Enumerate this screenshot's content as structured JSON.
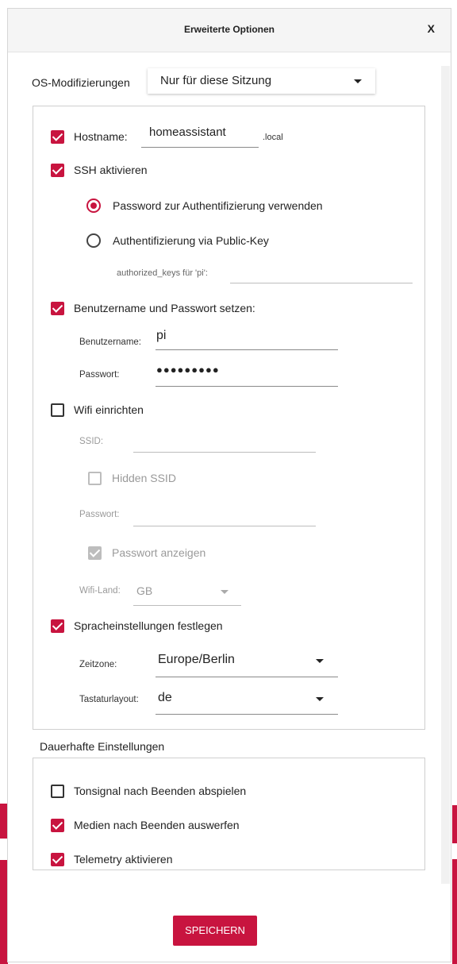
{
  "dialog": {
    "title": "Erweiterte Optionen",
    "close": "X"
  },
  "os_mod": {
    "label": "OS-Modifizierungen",
    "value": "Nur für diese Sitzung"
  },
  "hostname": {
    "label": "Hostname:",
    "value": "homeassistant",
    "suffix": ".local",
    "checked": true
  },
  "ssh": {
    "label": "SSH aktivieren",
    "checked": true,
    "opt_password": "Password zur Authentifizierung verwenden",
    "opt_pubkey": "Authentifizierung via Public-Key",
    "keys_label": "authorized_keys für 'pi':",
    "selected": "password"
  },
  "user": {
    "label": "Benutzername und Passwort setzen:",
    "checked": true,
    "username_label": "Benutzername:",
    "username": "pi",
    "password_label": "Passwort:",
    "password": "●●●●●●●●●"
  },
  "wifi": {
    "label": "Wifi einrichten",
    "checked": false,
    "ssid_label": "SSID:",
    "hidden_label": "Hidden SSID",
    "password_label": "Passwort:",
    "show_password_label": "Passwort anzeigen",
    "country_label": "Wifi-Land:",
    "country": "GB"
  },
  "locale": {
    "label": "Spracheinstellungen festlegen",
    "checked": true,
    "tz_label": "Zeitzone:",
    "tz": "Europe/Berlin",
    "kb_label": "Tastaturlayout:",
    "kb": "de"
  },
  "persistent": {
    "heading": "Dauerhafte Einstellungen",
    "beep": "Tonsignal nach Beenden abspielen",
    "beep_checked": false,
    "eject": "Medien nach Beenden auswerfen",
    "eject_checked": true,
    "telemetry": "Telemetry aktivieren",
    "telemetry_checked": true
  },
  "save_button": "SPEICHERN",
  "colors": {
    "accent": "#c8143f"
  }
}
